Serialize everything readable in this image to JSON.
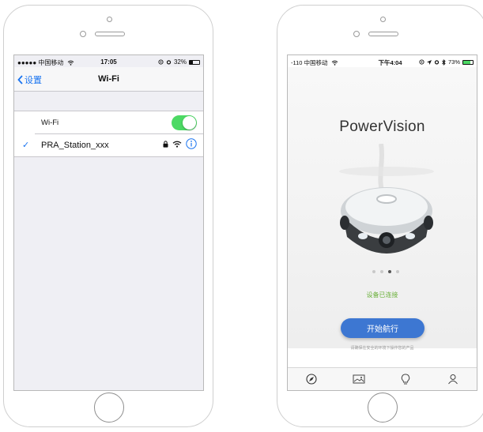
{
  "left_phone": {
    "status_bar": {
      "carrier": "●●●●● 中国移动",
      "time": "17:05",
      "battery": "32%",
      "battery_level": 0.32
    },
    "nav": {
      "back_label": "设置",
      "title": "Wi-Fi"
    },
    "wifi_row": {
      "label": "Wi-Fi",
      "toggle_on": true
    },
    "network": {
      "name": "PRA_Station_xxx",
      "connected": true,
      "secured": true
    }
  },
  "right_phone": {
    "status_bar": {
      "carrier": "-110 中国移动",
      "time": "下午4:04",
      "battery": "73%",
      "battery_level": 0.73
    },
    "brand": "PowerVision",
    "pager": {
      "count": 4,
      "active_index": 2
    },
    "connection_status": "设备已连接",
    "start_button": "开始航行",
    "safety_note": "请确保在安全的环境下操作您的产品",
    "tabs": [
      "compass-icon",
      "photo-icon",
      "lightbulb-icon",
      "profile-icon"
    ]
  },
  "colors": {
    "ios_blue": "#1a74f0",
    "toggle_green": "#4cd964",
    "connected_green": "#6ab03a",
    "start_button_blue": "#3d77d2"
  }
}
